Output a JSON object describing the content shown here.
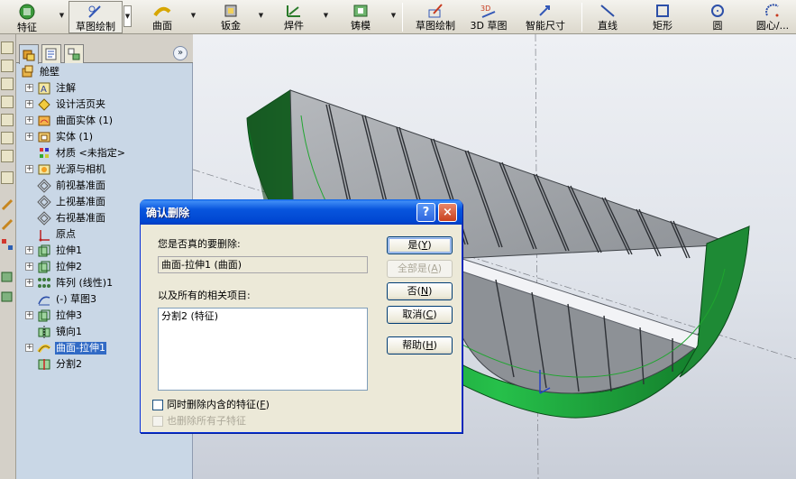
{
  "toolbar": {
    "buttons": [
      {
        "label": "特征",
        "icon": "features-icon"
      },
      {
        "label": "草图绘制",
        "icon": "sketch-icon"
      },
      {
        "label": "曲面",
        "icon": "surface-icon"
      },
      {
        "label": "钣金",
        "icon": "sheet-metal-icon"
      },
      {
        "label": "焊件",
        "icon": "weldment-icon"
      },
      {
        "label": "铸模",
        "icon": "mold-icon"
      },
      {
        "label": "草图绘制",
        "icon": "sketch-draw-icon"
      },
      {
        "label": "3D 草图",
        "icon": "3d-sketch-icon"
      },
      {
        "label": "智能尺寸",
        "icon": "smart-dimension-icon"
      },
      {
        "label": "直线",
        "icon": "line-icon"
      },
      {
        "label": "矩形",
        "icon": "rectangle-icon"
      },
      {
        "label": "圆",
        "icon": "circle-icon"
      },
      {
        "label": "圆心/...",
        "icon": "center-arc-icon"
      }
    ]
  },
  "feature_manager": {
    "tabs": [
      "feature-tree-tab",
      "property-manager-tab",
      "configuration-manager-tab"
    ],
    "expand_glyph": "»",
    "tree": [
      {
        "label": "舱壁",
        "icon": "part-icon",
        "expand": ""
      },
      {
        "label": "注解",
        "icon": "annotation-icon",
        "expand": "+"
      },
      {
        "label": "设计活页夹",
        "icon": "design-binder-icon",
        "expand": "+"
      },
      {
        "label": "曲面实体 (1)",
        "icon": "surface-bodies-icon",
        "expand": "+"
      },
      {
        "label": "实体 (1)",
        "icon": "solid-bodies-icon",
        "expand": "+"
      },
      {
        "label": "材质 <未指定>",
        "icon": "material-icon",
        "expand": ""
      },
      {
        "label": "光源与相机",
        "icon": "lights-cameras-icon",
        "expand": "+"
      },
      {
        "label": "前视基准面",
        "icon": "plane-icon",
        "expand": ""
      },
      {
        "label": "上视基准面",
        "icon": "plane-icon",
        "expand": ""
      },
      {
        "label": "右视基准面",
        "icon": "plane-icon",
        "expand": ""
      },
      {
        "label": "原点",
        "icon": "origin-icon",
        "expand": ""
      },
      {
        "label": "拉伸1",
        "icon": "extrude-icon",
        "expand": "+"
      },
      {
        "label": "拉伸2",
        "icon": "extrude-icon",
        "expand": "+"
      },
      {
        "label": "阵列 (线性)1",
        "icon": "linear-pattern-icon",
        "expand": "+"
      },
      {
        "label": "(-) 草图3",
        "icon": "sketch-feature-icon",
        "expand": ""
      },
      {
        "label": "拉伸3",
        "icon": "extrude-icon",
        "expand": "+"
      },
      {
        "label": "镜向1",
        "icon": "mirror-icon",
        "expand": ""
      },
      {
        "label": "曲面-拉伸1",
        "icon": "surface-extrude-icon",
        "expand": "+",
        "selected": true
      },
      {
        "label": "分割2",
        "icon": "split-icon",
        "expand": ""
      }
    ]
  },
  "dialog": {
    "title": "确认删除",
    "help_caption": "?",
    "close_caption": "×",
    "question": "您是否真的要删除:",
    "item": "曲面-拉伸1 (曲面)",
    "related_label": "以及所有的相关项目:",
    "related_items": [
      "分割2 (特征)"
    ],
    "buttons": {
      "yes": {
        "text": "是",
        "key": "Y"
      },
      "yes_all": {
        "text": "全部是",
        "key": "A"
      },
      "no": {
        "text": "否",
        "key": "N"
      },
      "cancel": {
        "text": "取消",
        "key": "C"
      },
      "help": {
        "text": "帮助",
        "key": "H"
      }
    },
    "checkbox_delete_absorbed": {
      "text": "同时删除内含的特征",
      "key": "F",
      "checked": false,
      "enabled": true
    },
    "checkbox_delete_children": {
      "text": "也删除所有子特征",
      "checked": false,
      "enabled": false
    }
  },
  "colors": {
    "title_bar": "#0a5fe6",
    "tree_background": "#c9d7e6",
    "selection": "#316ac5",
    "surface_green": "#1ea83a",
    "panel_gray": "#9fa3a8"
  }
}
